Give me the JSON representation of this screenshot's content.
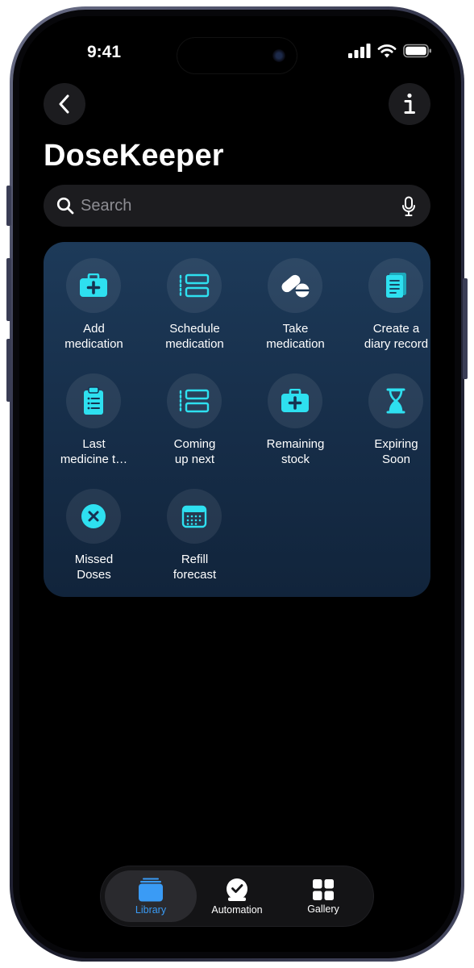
{
  "status_bar": {
    "time": "9:41"
  },
  "header": {
    "title": "DoseKeeper"
  },
  "search": {
    "placeholder": "Search"
  },
  "actions": [
    {
      "label": "Add\nmedication",
      "icon": "medical-kit-icon"
    },
    {
      "label": "Schedule\nmedication",
      "icon": "schedule-list-icon"
    },
    {
      "label": "Take\nmedication",
      "icon": "pills-icon"
    },
    {
      "label": "Create a\ndiary record",
      "icon": "diary-icon"
    },
    {
      "label": "Last\nmedicine t…",
      "icon": "clipboard-icon"
    },
    {
      "label": "Coming\nup next",
      "icon": "schedule-list-icon"
    },
    {
      "label": "Remaining\nstock",
      "icon": "medical-kit-icon"
    },
    {
      "label": "Expiring\nSoon",
      "icon": "hourglass-icon"
    },
    {
      "label": "Missed\nDoses",
      "icon": "x-circle-icon"
    },
    {
      "label": "Refill\nforecast",
      "icon": "calendar-icon"
    }
  ],
  "tabs": [
    {
      "label": "Library",
      "icon": "library-icon",
      "active": true
    },
    {
      "label": "Automation",
      "icon": "clock-check-icon",
      "active": false
    },
    {
      "label": "Gallery",
      "icon": "grid-icon",
      "active": false
    }
  ],
  "colors": {
    "accent_icon": "#2ee0f0",
    "active_tab": "#3a9bf5",
    "panel_top": "#1d3a59",
    "panel_bottom": "#11243b"
  }
}
